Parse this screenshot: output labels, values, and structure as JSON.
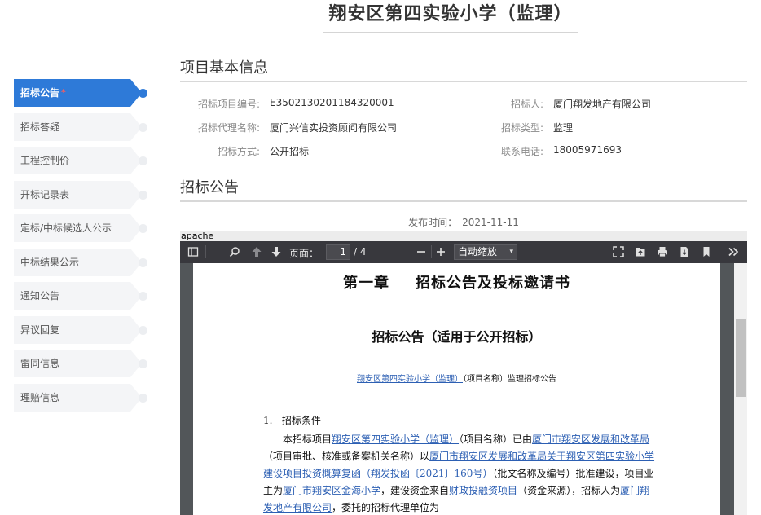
{
  "page": {
    "title": "翔安区第四实验小学（监理）"
  },
  "sidebar": {
    "items": [
      {
        "label": "招标公告",
        "marker": "*"
      },
      {
        "label": "招标答疑"
      },
      {
        "label": "工程控制价"
      },
      {
        "label": "开标记录表"
      },
      {
        "label": "定标/中标候选人公示"
      },
      {
        "label": "中标结果公示"
      },
      {
        "label": "通知公告"
      },
      {
        "label": "异议回复"
      },
      {
        "label": "雷同信息"
      },
      {
        "label": "理赔信息"
      }
    ]
  },
  "basic_info": {
    "title": "项目基本信息",
    "project_no_label": "招标项目编号:",
    "project_no": "E3502130201184320001",
    "tenderer_label": "招标人:",
    "tenderer": "厦门翔发地产有限公司",
    "agency_label": "招标代理名称:",
    "agency": "厦门兴信实投资顾问有限公司",
    "tender_type_label": "招标类型:",
    "tender_type": "监理",
    "method_label": "招标方式:",
    "method": "公开招标",
    "phone_label": "联系电话:",
    "phone": "18005971693"
  },
  "announcement": {
    "title": "招标公告",
    "publish_label": "发布时间：",
    "publish_date": "2021-11-11"
  },
  "pdf_viewer": {
    "frame_label": "apache",
    "page_label": "页面：",
    "current_page": "1",
    "total_pages": "/ 4",
    "zoom": "自动缩放",
    "doc": {
      "chapter_num": "第一章",
      "chapter_title": "招标公告及投标邀请书",
      "subtitle": "招标公告（适用于公开招标）",
      "line_project": "翔安区第四实验小学（监理）",
      "line_rest": "（项目名称）监理招标公告",
      "section_no": "1.",
      "section_title": "招标条件",
      "para_1": "本招标项目",
      "para_proj": "翔安区第四实验小学（监理）",
      "para_2": "（项目名称）已由",
      "para_agency": "厦门市翔安区发展和改革局",
      "para_3": "（项目审批、核准或备案机关名称）以",
      "para_doc": "厦门市翔安区发展和改革局关于翔安区第四实验小学建设项目投资概算复函（翔发投函〔2021〕160号）",
      "para_4": "（批文名称及编号）批准建设，项目业主为",
      "para_owner": "厦门市翔安区金海小学",
      "para_5": "，建设资金来自",
      "para_fund": "财政投融资项目",
      "para_6": "（资金来源），招标人为",
      "para_tenderer": "厦门翔发地产有限公司",
      "para_7": "，委托的招标代理单位为"
    }
  }
}
